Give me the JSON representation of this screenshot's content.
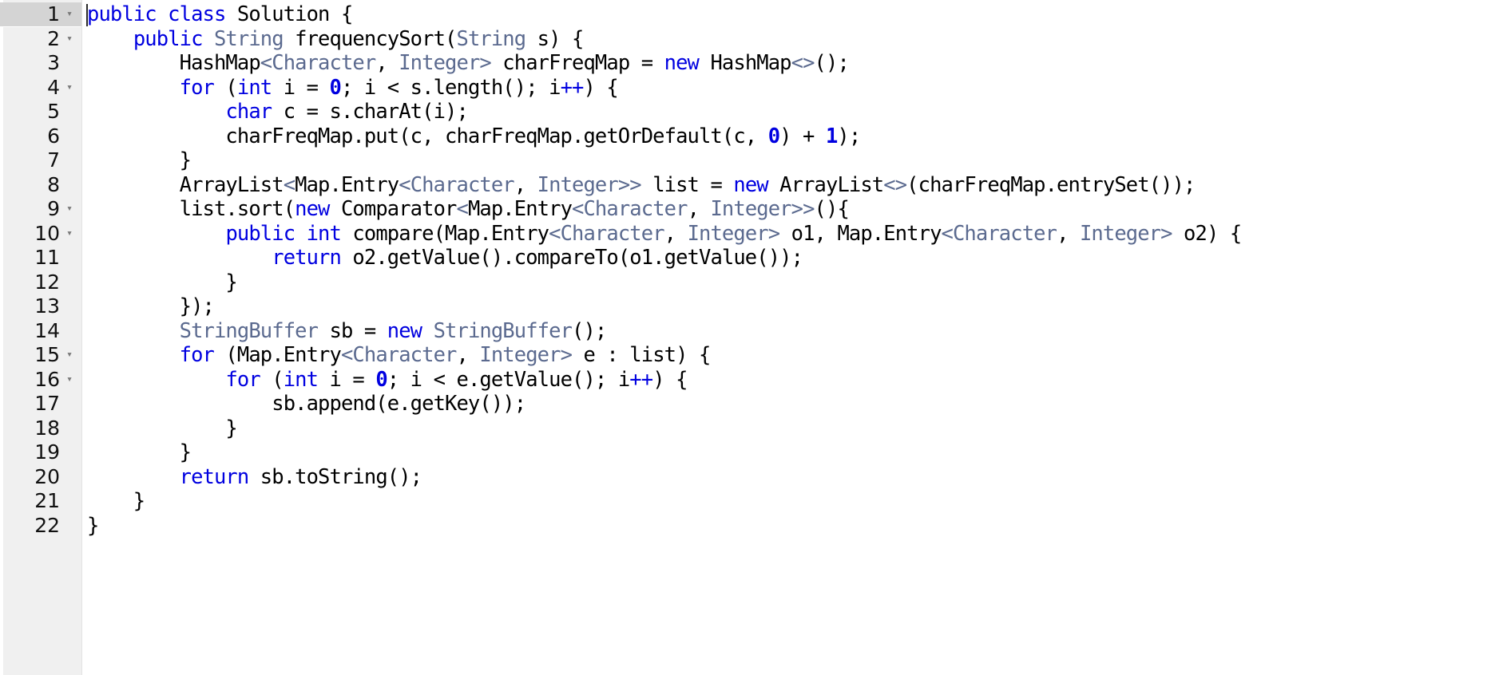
{
  "editor": {
    "language": "java",
    "active_line": 1,
    "total_lines": 22,
    "gutter_background": "#f0f0f0",
    "active_line_background": "#d4d4d4",
    "colors": {
      "keyword": "#0000e0",
      "type": "#5b6a8f",
      "plain": "#000000",
      "number": "#0000e0",
      "background": "#ffffff"
    },
    "fold_glyph": "▾"
  },
  "lines": [
    {
      "number": "1",
      "foldable": true,
      "active": true,
      "tokens": [
        {
          "t": "public",
          "c": "kw"
        },
        {
          "t": " ",
          "c": "pl"
        },
        {
          "t": "class",
          "c": "kw"
        },
        {
          "t": " Solution {",
          "c": "pl"
        }
      ]
    },
    {
      "number": "2",
      "foldable": true,
      "active": false,
      "tokens": [
        {
          "t": "    ",
          "c": "pl"
        },
        {
          "t": "public",
          "c": "kw"
        },
        {
          "t": " ",
          "c": "pl"
        },
        {
          "t": "String",
          "c": "typ"
        },
        {
          "t": " frequencySort(",
          "c": "pl"
        },
        {
          "t": "String",
          "c": "typ"
        },
        {
          "t": " s) {",
          "c": "pl"
        }
      ]
    },
    {
      "number": "3",
      "foldable": false,
      "active": false,
      "tokens": [
        {
          "t": "        HashMap",
          "c": "pl"
        },
        {
          "t": "<",
          "c": "gen"
        },
        {
          "t": "Character",
          "c": "typ"
        },
        {
          "t": ", ",
          "c": "pl"
        },
        {
          "t": "Integer",
          "c": "typ"
        },
        {
          "t": ">",
          "c": "gen"
        },
        {
          "t": " charFreqMap = ",
          "c": "pl"
        },
        {
          "t": "new",
          "c": "kw"
        },
        {
          "t": " HashMap",
          "c": "pl"
        },
        {
          "t": "<>",
          "c": "gen"
        },
        {
          "t": "();",
          "c": "pl"
        }
      ]
    },
    {
      "number": "4",
      "foldable": true,
      "active": false,
      "tokens": [
        {
          "t": "        ",
          "c": "pl"
        },
        {
          "t": "for",
          "c": "kw"
        },
        {
          "t": " (",
          "c": "pl"
        },
        {
          "t": "int",
          "c": "kw"
        },
        {
          "t": " i = ",
          "c": "pl"
        },
        {
          "t": "0",
          "c": "num"
        },
        {
          "t": "; i < s.length(); i",
          "c": "pl"
        },
        {
          "t": "++",
          "c": "op"
        },
        {
          "t": ") {",
          "c": "pl"
        }
      ]
    },
    {
      "number": "5",
      "foldable": false,
      "active": false,
      "tokens": [
        {
          "t": "            ",
          "c": "pl"
        },
        {
          "t": "char",
          "c": "kw"
        },
        {
          "t": " c = s.charAt(i);",
          "c": "pl"
        }
      ]
    },
    {
      "number": "6",
      "foldable": false,
      "active": false,
      "tokens": [
        {
          "t": "            charFreqMap.put(c, charFreqMap.getOrDefault(c, ",
          "c": "pl"
        },
        {
          "t": "0",
          "c": "num"
        },
        {
          "t": ") + ",
          "c": "pl"
        },
        {
          "t": "1",
          "c": "num"
        },
        {
          "t": ");",
          "c": "pl"
        }
      ]
    },
    {
      "number": "7",
      "foldable": false,
      "active": false,
      "tokens": [
        {
          "t": "        }",
          "c": "pl"
        }
      ]
    },
    {
      "number": "8",
      "foldable": false,
      "active": false,
      "tokens": [
        {
          "t": "        ArrayList",
          "c": "pl"
        },
        {
          "t": "<",
          "c": "gen"
        },
        {
          "t": "Map.Entry",
          "c": "pl"
        },
        {
          "t": "<",
          "c": "gen"
        },
        {
          "t": "Character",
          "c": "typ"
        },
        {
          "t": ", ",
          "c": "pl"
        },
        {
          "t": "Integer",
          "c": "typ"
        },
        {
          "t": ">>",
          "c": "gen"
        },
        {
          "t": " list = ",
          "c": "pl"
        },
        {
          "t": "new",
          "c": "kw"
        },
        {
          "t": " ArrayList",
          "c": "pl"
        },
        {
          "t": "<>",
          "c": "gen"
        },
        {
          "t": "(charFreqMap.entrySet());",
          "c": "pl"
        }
      ]
    },
    {
      "number": "9",
      "foldable": true,
      "active": false,
      "tokens": [
        {
          "t": "        list.sort(",
          "c": "pl"
        },
        {
          "t": "new",
          "c": "kw"
        },
        {
          "t": " Comparator",
          "c": "pl"
        },
        {
          "t": "<",
          "c": "gen"
        },
        {
          "t": "Map.Entry",
          "c": "pl"
        },
        {
          "t": "<",
          "c": "gen"
        },
        {
          "t": "Character",
          "c": "typ"
        },
        {
          "t": ", ",
          "c": "pl"
        },
        {
          "t": "Integer",
          "c": "typ"
        },
        {
          "t": ">>",
          "c": "gen"
        },
        {
          "t": "(){",
          "c": "pl"
        }
      ]
    },
    {
      "number": "10",
      "foldable": true,
      "active": false,
      "tokens": [
        {
          "t": "            ",
          "c": "pl"
        },
        {
          "t": "public",
          "c": "kw"
        },
        {
          "t": " ",
          "c": "pl"
        },
        {
          "t": "int",
          "c": "kw"
        },
        {
          "t": " compare(Map.Entry",
          "c": "pl"
        },
        {
          "t": "<",
          "c": "gen"
        },
        {
          "t": "Character",
          "c": "typ"
        },
        {
          "t": ", ",
          "c": "pl"
        },
        {
          "t": "Integer",
          "c": "typ"
        },
        {
          "t": ">",
          "c": "gen"
        },
        {
          "t": " o1, Map.Entry",
          "c": "pl"
        },
        {
          "t": "<",
          "c": "gen"
        },
        {
          "t": "Character",
          "c": "typ"
        },
        {
          "t": ", ",
          "c": "pl"
        },
        {
          "t": "Integer",
          "c": "typ"
        },
        {
          "t": ">",
          "c": "gen"
        },
        {
          "t": " o2) {",
          "c": "pl"
        }
      ]
    },
    {
      "number": "11",
      "foldable": false,
      "active": false,
      "tokens": [
        {
          "t": "                ",
          "c": "pl"
        },
        {
          "t": "return",
          "c": "kw"
        },
        {
          "t": " o2.getValue().compareTo(o1.getValue());",
          "c": "pl"
        }
      ]
    },
    {
      "number": "12",
      "foldable": false,
      "active": false,
      "tokens": [
        {
          "t": "            }",
          "c": "pl"
        }
      ]
    },
    {
      "number": "13",
      "foldable": false,
      "active": false,
      "tokens": [
        {
          "t": "        });",
          "c": "pl"
        }
      ]
    },
    {
      "number": "14",
      "foldable": false,
      "active": false,
      "tokens": [
        {
          "t": "        ",
          "c": "pl"
        },
        {
          "t": "StringBuffer",
          "c": "typ"
        },
        {
          "t": " sb = ",
          "c": "pl"
        },
        {
          "t": "new",
          "c": "kw"
        },
        {
          "t": " ",
          "c": "pl"
        },
        {
          "t": "StringBuffer",
          "c": "typ"
        },
        {
          "t": "();",
          "c": "pl"
        }
      ]
    },
    {
      "number": "15",
      "foldable": true,
      "active": false,
      "tokens": [
        {
          "t": "        ",
          "c": "pl"
        },
        {
          "t": "for",
          "c": "kw"
        },
        {
          "t": " (Map.Entry",
          "c": "pl"
        },
        {
          "t": "<",
          "c": "gen"
        },
        {
          "t": "Character",
          "c": "typ"
        },
        {
          "t": ", ",
          "c": "pl"
        },
        {
          "t": "Integer",
          "c": "typ"
        },
        {
          "t": ">",
          "c": "gen"
        },
        {
          "t": " e : list) {",
          "c": "pl"
        }
      ]
    },
    {
      "number": "16",
      "foldable": true,
      "active": false,
      "tokens": [
        {
          "t": "            ",
          "c": "pl"
        },
        {
          "t": "for",
          "c": "kw"
        },
        {
          "t": " (",
          "c": "pl"
        },
        {
          "t": "int",
          "c": "kw"
        },
        {
          "t": " i = ",
          "c": "pl"
        },
        {
          "t": "0",
          "c": "num"
        },
        {
          "t": "; i < e.getValue(); i",
          "c": "pl"
        },
        {
          "t": "++",
          "c": "op"
        },
        {
          "t": ") {",
          "c": "pl"
        }
      ]
    },
    {
      "number": "17",
      "foldable": false,
      "active": false,
      "tokens": [
        {
          "t": "                sb.append(e.getKey());",
          "c": "pl"
        }
      ]
    },
    {
      "number": "18",
      "foldable": false,
      "active": false,
      "tokens": [
        {
          "t": "            }",
          "c": "pl"
        }
      ]
    },
    {
      "number": "19",
      "foldable": false,
      "active": false,
      "tokens": [
        {
          "t": "        }",
          "c": "pl"
        }
      ]
    },
    {
      "number": "20",
      "foldable": false,
      "active": false,
      "tokens": [
        {
          "t": "        ",
          "c": "pl"
        },
        {
          "t": "return",
          "c": "kw"
        },
        {
          "t": " sb.toString();",
          "c": "pl"
        }
      ]
    },
    {
      "number": "21",
      "foldable": false,
      "active": false,
      "tokens": [
        {
          "t": "    }",
          "c": "pl"
        }
      ]
    },
    {
      "number": "22",
      "foldable": false,
      "active": false,
      "tokens": [
        {
          "t": "}",
          "c": "pl"
        }
      ]
    }
  ]
}
